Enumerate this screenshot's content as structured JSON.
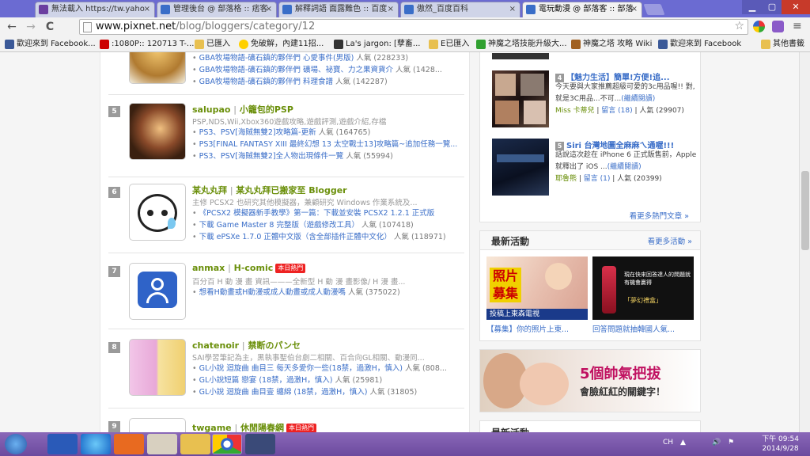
{
  "tabs": [
    {
      "label": "無法載入 https://tw.yaho",
      "color": "#6b3fa0",
      "active": false
    },
    {
      "label": "管理後台 @ 部落格 :: 痞客",
      "color": "#3a6ec8",
      "active": false
    },
    {
      "label": "解釋詞語 面露難色 :: 百度",
      "color": "#3a6ec8",
      "active": false
    },
    {
      "label": "傲然_百度百科",
      "color": "#3a6ec8",
      "active": false
    },
    {
      "label": "電玩動漫 @ 部落客 :: 部落",
      "color": "#3a6ec8",
      "active": true
    }
  ],
  "window_controls": {
    "minimize": "▁",
    "maximize": "▢",
    "close": "✕"
  },
  "toolbar": {
    "back": "←",
    "forward": "→",
    "reload": "C",
    "url_host": "www.pixnet.net",
    "url_path": "/blog/bloggers/category/12"
  },
  "bookmarks": [
    {
      "label": "歡迎來到 Facebook...",
      "color": "#3b5998"
    },
    {
      "label": ":1080P:: 120713 T-...",
      "color": "#cc0000"
    },
    {
      "label": "已匯入",
      "color": "#e8c050"
    },
    {
      "label": "免破解，內建11招...",
      "color": "#ffd000"
    },
    {
      "label": "La's jargon: [孽畜...",
      "color": "#333333"
    },
    {
      "label": "E已匯入",
      "color": "#e8c050"
    },
    {
      "label": "神魔之塔技能升級大...",
      "color": "#30a030"
    },
    {
      "label": "神魔之塔 攻略 Wiki",
      "color": "#a06020"
    },
    {
      "label": "歡迎來到 Facebook",
      "color": "#3b5998"
    },
    {
      "label": "其他書籤",
      "color": "#e8c050"
    }
  ],
  "entries": [
    {
      "rank": "",
      "author": "",
      "blog": "",
      "desc": "",
      "posts": [
        {
          "title": "GBA牧場物語-礦石鎮的夥伴們 心愛事件(男版)",
          "views": "人氣 (228233)"
        },
        {
          "title": "GBA牧場物語-礦石鎮的夥伴們 礦場、祕寶、力之果資貨介",
          "views": "人氣 (1428..."
        },
        {
          "title": "GBA牧場物語-礦石鎮的夥伴們 料理食譜",
          "views": "人氣 (142287)"
        }
      ]
    },
    {
      "rank": "5",
      "author": "salupao",
      "blog": "小籠包的PSP",
      "desc": "PSP,NDS,Wii,Xbox360遊戲攻略,遊戲評測,遊戲介紹,存檔",
      "posts": [
        {
          "title": "PS3、PSV[海賊無雙2]攻略篇-更新",
          "views": "人氣 (164765)"
        },
        {
          "title": "PS3[FINAL FANTASY XIII 最終幻想 13 太空戰士13]攻略篇~追加任務一覽...",
          "views": ""
        },
        {
          "title": "PS3、PSV[海賊無雙2]全人物出現條件一覽",
          "views": "人氣 (55994)"
        }
      ]
    },
    {
      "rank": "6",
      "author": "某丸丸拜",
      "blog": "某丸丸拜已搬家至 Blogger",
      "desc": "主修 PCSX2 也研究其他模擬器，兼顧研究 Windows 作業系統及...",
      "posts": [
        {
          "title": "《PCSX2 模擬器新手教學》第一篇：下載並安裝 PCSX2 1.2.1 正式版",
          "views": ""
        },
        {
          "title": "下載 Game Master 8 完整版（遊戲修改工具）",
          "views": "人氣 (107418)"
        },
        {
          "title": "下載 ePSXe 1.7.0 正體中文版（含全部插件正體中文化）",
          "views": "人氣 (118971)"
        }
      ]
    },
    {
      "rank": "7",
      "author": "anmax",
      "blog": "H-comic",
      "hot": "本日熱門",
      "desc": "百分百 H 動 漫 畫 資訊———全新型 H 動 漫 畫影像/ H 漫 畫...",
      "posts": [
        {
          "title": "想看H動畫或H動漫或成人動畫或成人動漫嗎",
          "views": "人氣 (375022)"
        }
      ]
    },
    {
      "rank": "8",
      "author": "chatenoir",
      "blog": "禁断のパンセ",
      "desc": "SAI學習筆記為主，黑執事聖伯台劇二相關、百合向GL相關、動漫同...",
      "posts": [
        {
          "title": "GL小說 迴旋曲 曲目三 每天多愛你一些(18禁，過激H，慎入)",
          "views": "人氣 (808..."
        },
        {
          "title": "GL小說短篇 戀宴 (18禁，過激H，慎入)",
          "views": "人氣 (25981)"
        },
        {
          "title": "GL小說 迴旋曲 曲目壹 纏綿 (18禁，過激H，慎入)",
          "views": "人氣 (31805)"
        }
      ]
    },
    {
      "rank": "9",
      "author": "twgame",
      "blog": "休閒陽春網",
      "hot": "本日熱門",
      "desc": "",
      "posts": []
    }
  ],
  "sidebar": {
    "hot_items": [
      {
        "num": "4",
        "title": "【魅力生活】簡單!方便!追...",
        "text": "今天要與大家推薦超級可愛的3c用品喔!! 對,就是3C用品...不可...",
        "read": "(繼續閱讀)",
        "author": "Miss 卡蒂兒",
        "comments": "留言 (18)",
        "views": "人氣 (29907)"
      },
      {
        "num": "5",
        "title": "Siri 台灣地圖全麻麻ㄟ通喔!!!",
        "text": "話說這次趁在 iPhone 6 正式販售前，Apple 就釋出了 iOS ...",
        "read": "(繼續閱讀)",
        "author": "耶魯熊",
        "comments": "留言 (1)",
        "views": "人氣 (20399)"
      }
    ],
    "more_hot": "看更多熱門文章 »",
    "events": {
      "heading": "最新活動",
      "more": "看更多活動 »",
      "items": [
        {
          "caption": "【募集】你的照片上東...",
          "banner": "照片募集",
          "sub": "投稿上東森電視"
        },
        {
          "caption": "回答問題就抽韓國人氣...",
          "banner": "現在快來回答達人的問題就有機會贏得",
          "sub": "「夢幻禮盒」"
        }
      ]
    },
    "ad": {
      "line1": "5個帥氣把拔",
      "line2": "會臉紅紅的關鍵字！"
    },
    "cut_heading": "最新活動"
  },
  "taskbar": {
    "time": "下午 09:54",
    "date": "2014/9/28",
    "tray": [
      "CH",
      "▲",
      "🔊",
      "⚑"
    ]
  }
}
